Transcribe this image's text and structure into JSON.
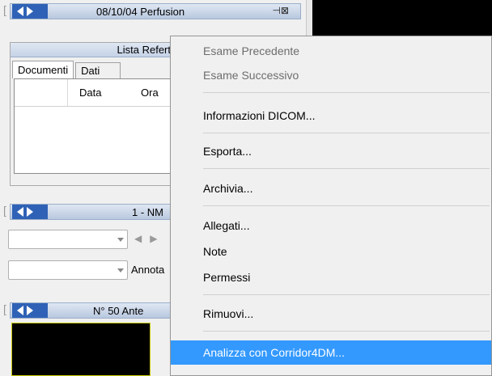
{
  "header_bar": {
    "title": "08/10/04 Perfusion",
    "pin_icon": "pin-icon"
  },
  "report_panel": {
    "title": "Lista Refert",
    "tabs": [
      "Documenti",
      "Dati"
    ],
    "columns": [
      "Data",
      "Ora"
    ]
  },
  "series_bar": {
    "title": "1 - NM"
  },
  "annotation_label": "Annota",
  "image_bar": {
    "title": "N° 50 Ante"
  },
  "context_menu": {
    "items": [
      {
        "label": "Esame Precedente",
        "enabled": false
      },
      {
        "label": "Esame Successivo",
        "enabled": false
      },
      {
        "label": "Informazioni DICOM...",
        "enabled": true
      },
      {
        "label": "Esporta...",
        "enabled": true
      },
      {
        "label": "Archivia...",
        "enabled": true
      },
      {
        "label": "Allegati...",
        "enabled": true
      },
      {
        "label": "Note",
        "enabled": true
      },
      {
        "label": "Permessi",
        "enabled": true
      },
      {
        "label": "Rimuovi...",
        "enabled": true
      },
      {
        "label": "Analizza con Corridor4DM...",
        "enabled": true,
        "highlighted": true
      }
    ]
  },
  "colors": {
    "highlight": "#3399ff",
    "bar_nav": "#2f62b6"
  }
}
